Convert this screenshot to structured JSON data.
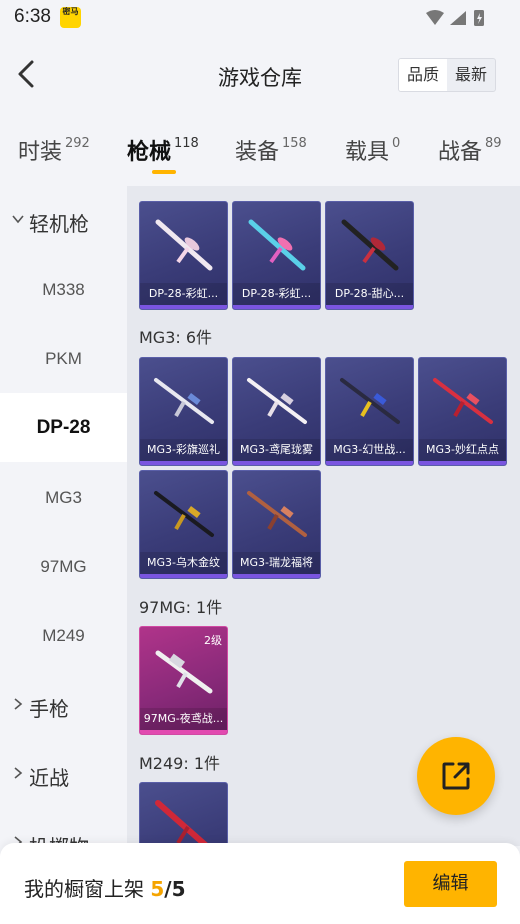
{
  "status": {
    "time": "6:38",
    "app_icon_text": "密马"
  },
  "header": {
    "title": "游戏仓库",
    "sort_options": [
      "品质",
      "最新"
    ]
  },
  "tabs": [
    {
      "label": "时装",
      "count": "292"
    },
    {
      "label": "枪械",
      "count": "118"
    },
    {
      "label": "装备",
      "count": "158"
    },
    {
      "label": "载具",
      "count": "0"
    },
    {
      "label": "战备",
      "count": "89"
    }
  ],
  "sidebar": {
    "groups": [
      "轻机枪",
      "手枪",
      "近战",
      "投掷物"
    ],
    "items": [
      "M338",
      "PKM",
      "DP-28",
      "MG3",
      "97MG",
      "M249"
    ],
    "active_item": "DP-28"
  },
  "sections": {
    "dp28_cards": [
      "DP-28-彩虹...",
      "DP-28-彩虹...",
      "DP-28-甜心..."
    ],
    "mg3_title": "MG3: 6件",
    "mg3_cards": [
      "MG3-彩旗巡礼",
      "MG3-鸢尾珑雾",
      "MG3-幻世战...",
      "MG3-妙红点点",
      "MG3-乌木金纹",
      "MG3-瑞龙福将"
    ],
    "mg97_title": "97MG: 1件",
    "mg97_cards": [
      "97MG-夜鸢战..."
    ],
    "mg97_level": "2级",
    "m249_title": "M249: 1件"
  },
  "bottom": {
    "label": "我的橱窗上架",
    "current": "5",
    "separator": "/",
    "total": "5",
    "edit_label": "编辑"
  },
  "colors": {
    "accent": "#ffb400",
    "card_purple": "#3a3c78",
    "card_pink": "#8a2a7a",
    "active_tab_underline": "#ffb400"
  },
  "icons": {
    "back": "chevron-left-icon",
    "fab": "share-external-icon",
    "group_expanded": "chevron-down-icon",
    "group_collapsed": "chevron-right-icon"
  }
}
